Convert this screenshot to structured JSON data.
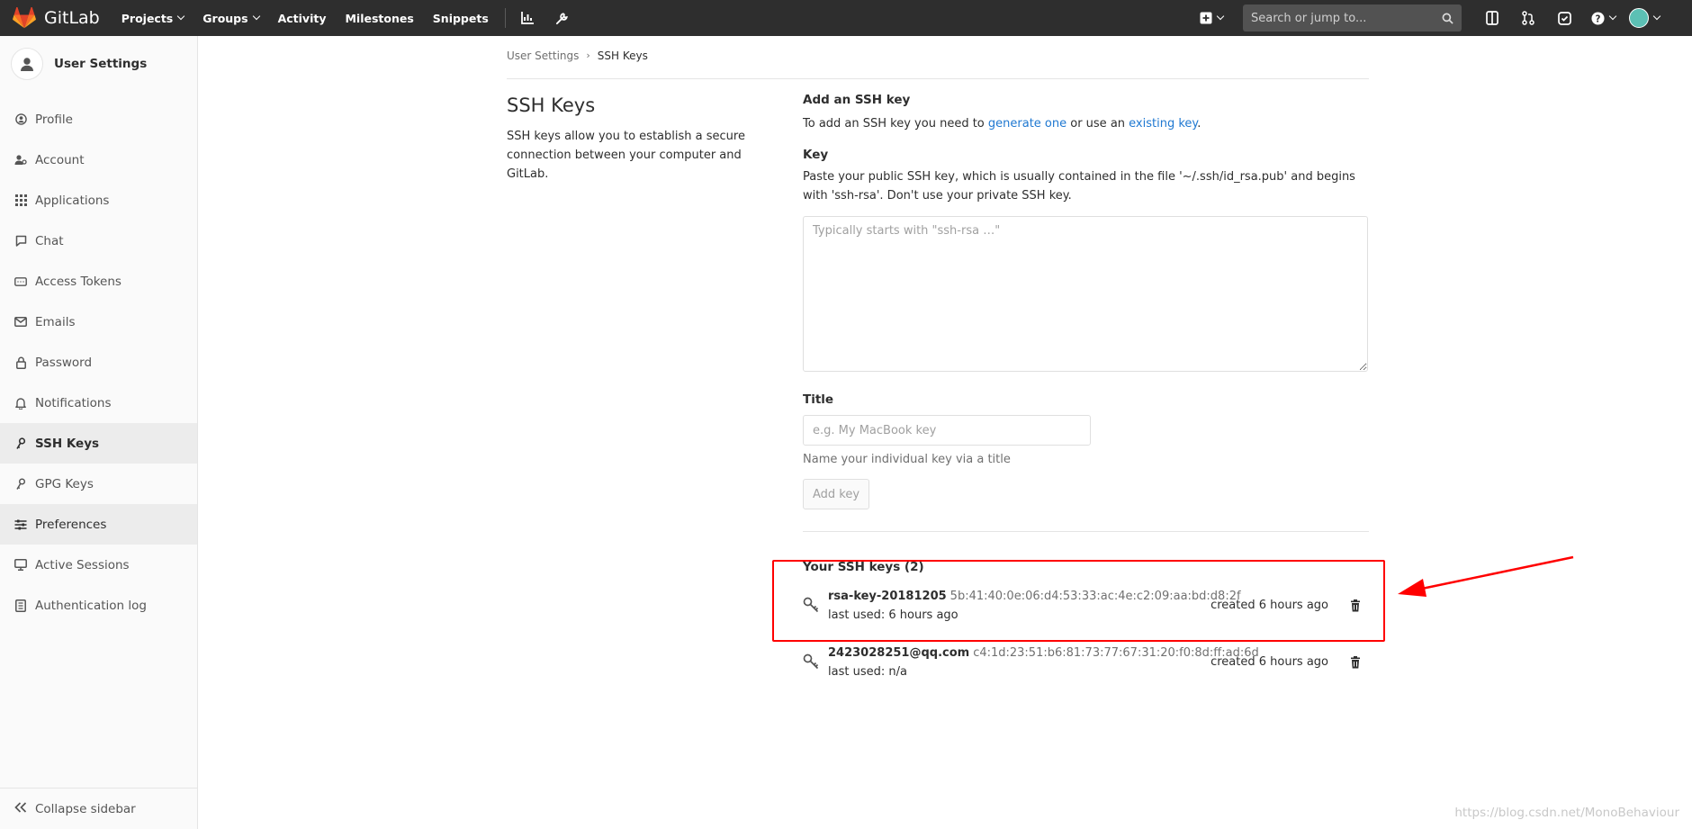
{
  "navbar": {
    "brand": "GitLab",
    "links": [
      {
        "label": "Projects",
        "dropdown": true
      },
      {
        "label": "Groups",
        "dropdown": true
      },
      {
        "label": "Activity",
        "dropdown": false
      },
      {
        "label": "Milestones",
        "dropdown": false
      },
      {
        "label": "Snippets",
        "dropdown": false
      }
    ],
    "icons": [
      "chart-icon",
      "wrench-icon"
    ],
    "search_placeholder": "Search or jump to...",
    "right_icons": [
      "plus-square-icon",
      "todo-panel-icon",
      "merge-request-icon",
      "check-square-icon",
      "question-icon",
      "user-avatar-icon"
    ]
  },
  "sidebar": {
    "title": "User Settings",
    "items": [
      {
        "label": "Profile",
        "icon": "profile-icon"
      },
      {
        "label": "Account",
        "icon": "account-icon"
      },
      {
        "label": "Applications",
        "icon": "applications-icon"
      },
      {
        "label": "Chat",
        "icon": "chat-icon"
      },
      {
        "label": "Access Tokens",
        "icon": "token-icon"
      },
      {
        "label": "Emails",
        "icon": "email-icon"
      },
      {
        "label": "Password",
        "icon": "lock-icon"
      },
      {
        "label": "Notifications",
        "icon": "bell-icon"
      },
      {
        "label": "SSH Keys",
        "icon": "key-icon",
        "active": true
      },
      {
        "label": "GPG Keys",
        "icon": "key-icon"
      },
      {
        "label": "Preferences",
        "icon": "preferences-icon"
      },
      {
        "label": "Active Sessions",
        "icon": "monitor-icon"
      },
      {
        "label": "Authentication log",
        "icon": "log-icon"
      }
    ],
    "collapse_label": "Collapse sidebar"
  },
  "breadcrumb": {
    "parent": "User Settings",
    "current": "SSH Keys"
  },
  "settings": {
    "title": "SSH Keys",
    "description": "SSH keys allow you to establish a secure connection between your computer and GitLab."
  },
  "form": {
    "heading": "Add an SSH key",
    "intro_prefix": "To add an SSH key you need to ",
    "link_generate": "generate one",
    "intro_middle": " or use an ",
    "link_existing": "existing key",
    "intro_suffix": ".",
    "key_label": "Key",
    "key_hint": "Paste your public SSH key, which is usually contained in the file '~/.ssh/id_rsa.pub' and begins with 'ssh-rsa'. Don't use your private SSH key.",
    "key_placeholder": "Typically starts with \"ssh-rsa …\"",
    "key_value": "",
    "title_label": "Title",
    "title_placeholder": "e.g. My MacBook key",
    "title_value": "",
    "title_help": "Name your individual key via a title",
    "submit_label": "Add key"
  },
  "keys": {
    "heading": "Your SSH keys (2)",
    "items": [
      {
        "name": "rsa-key-20181205",
        "fingerprint": "5b:41:40:0e:06:d4:53:33:ac:4e:c2:09:aa:bd:d8:2f",
        "last_used": "last used: 6 hours ago",
        "created": "created 6 hours ago"
      },
      {
        "name": "2423028251@qq.com",
        "fingerprint": "c4:1d:23:51:b6:81:73:77:67:31:20:f0:8d:ff:ad:6d",
        "last_used": "last used: n/a",
        "created": "created 6 hours ago"
      }
    ]
  },
  "watermark": "https://blog.csdn.net/MonoBehaviour",
  "colors": {
    "navbar": "#2e2e2e",
    "link": "#1f78d1",
    "annotation": "#ff0000",
    "brand_orange": "#fc6d26"
  }
}
